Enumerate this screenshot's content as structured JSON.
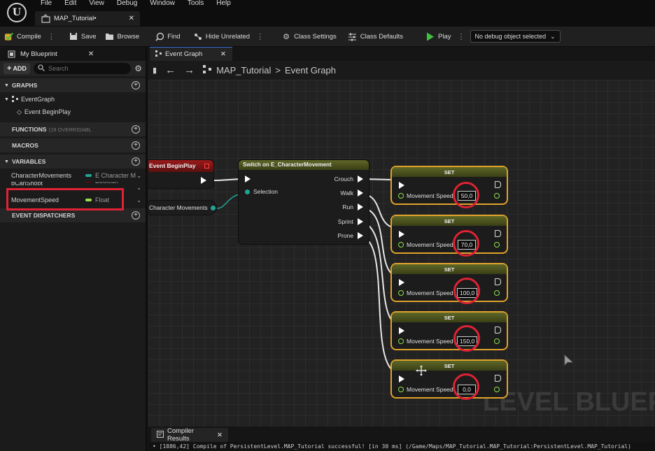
{
  "app": {
    "logo_letter": "U",
    "menus": [
      "File",
      "Edit",
      "View",
      "Debug",
      "Window",
      "Tools",
      "Help"
    ],
    "document_tab": "MAP_Tutorial•"
  },
  "toolbar": {
    "compile": "Compile",
    "save": "Save",
    "browse": "Browse",
    "find": "Find",
    "hide_unrelated": "Hide Unrelated",
    "class_settings": "Class Settings",
    "class_defaults": "Class Defaults",
    "play": "Play",
    "debug_object": "No debug object selected"
  },
  "left_panel": {
    "tab": "My Blueprint",
    "add": "ADD",
    "search_placeholder": "Search",
    "graphs_header": "GRAPHS",
    "event_graph": "EventGraph",
    "event_beginplay": "Event BeginPlay",
    "functions_header": "FUNCTIONS",
    "functions_sub": "(19 OVERRIDABL",
    "macros_header": "MACROS",
    "variables_header": "VARIABLES",
    "variables": [
      {
        "name": "CharacterMovements",
        "type": "E Character M",
        "color": "#1fa596"
      },
      {
        "name": "bCanShoot",
        "type": "Boolean",
        "color": "#8a0000"
      },
      {
        "name": "MovementSpeed",
        "type": "Float",
        "color": "#9be04b"
      }
    ],
    "dispatchers_header": "EVENT DISPATCHERS"
  },
  "graph": {
    "tab": "Event Graph",
    "breadcrumb_root": "MAP_Tutorial",
    "breadcrumb_sep": ">",
    "breadcrumb_leaf": "Event Graph",
    "watermark": "LEVEL BLUEP",
    "begin_play_node": "Event BeginPlay",
    "char_movements_node": "Character Movements",
    "switch_node": {
      "title": "Switch on E_CharacterMovement",
      "selection": "Selection",
      "outputs": [
        "Crouch",
        "Walk",
        "Run",
        "Sprint",
        "Prone"
      ]
    },
    "set_nodes": [
      {
        "title": "SET",
        "label": "Movement Speed",
        "value": "50,0"
      },
      {
        "title": "SET",
        "label": "Movement Speed",
        "value": "70,0"
      },
      {
        "title": "SET",
        "label": "Movement Speed",
        "value": "100,0"
      },
      {
        "title": "SET",
        "label": "Movement Speed",
        "value": "150,0"
      },
      {
        "title": "SET",
        "label": "Movement Speed",
        "value": "0,0"
      }
    ]
  },
  "bottom": {
    "tab": "Compiler Results",
    "log": "• [1886,42] Compile of PersistentLevel.MAP_Tutorial successful! [in 30 ms] (/Game/Maps/MAP_Tutorial.MAP_Tutorial:PersistentLevel.MAP_Tutorial)"
  }
}
